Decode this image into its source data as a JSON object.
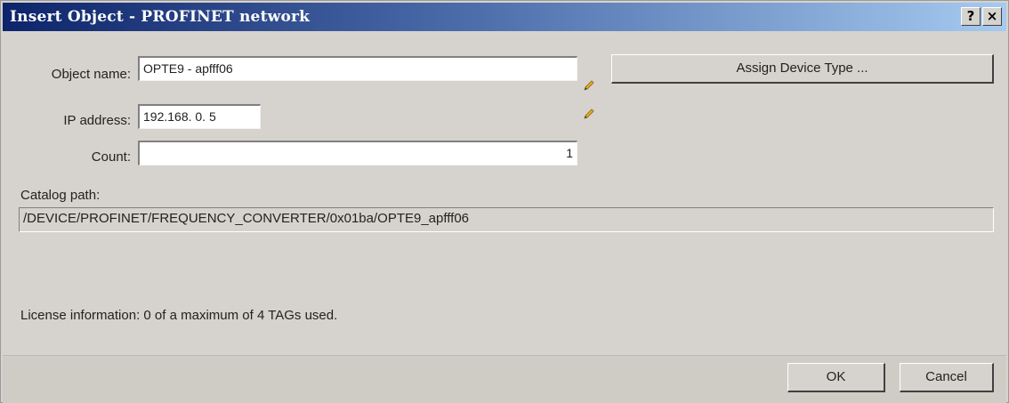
{
  "window": {
    "title": "Insert Object - PROFINET network",
    "help_label": "?",
    "close_label": "×"
  },
  "form": {
    "object_name_label": "Object name:",
    "object_name_value": "OPTE9 - apfff06",
    "ip_address_label": "IP address:",
    "ip_address_value": "192.168.  0.  5",
    "count_label": "Count:",
    "count_value": "1",
    "catalog_path_label": "Catalog path:",
    "catalog_path_value": "/DEVICE/PROFINET/FREQUENCY_CONVERTER/0x01ba/OPTE9_apfff06",
    "license_info": "License information: 0 of a maximum of 4 TAGs used."
  },
  "buttons": {
    "assign_device_type": "Assign Device Type ...",
    "ok": "OK",
    "cancel": "Cancel"
  },
  "icons": {
    "edit_name": "pencil-icon",
    "edit_ip": "pencil-icon"
  }
}
